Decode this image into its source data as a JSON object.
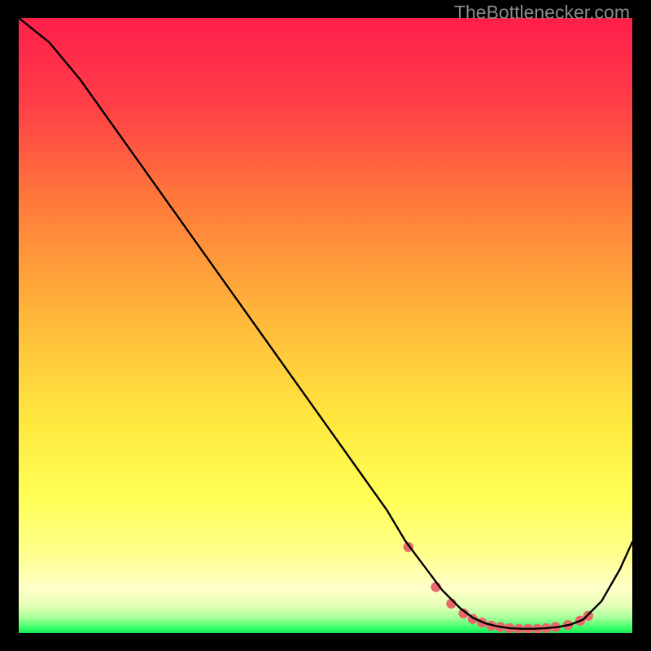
{
  "watermark": "TheBottlenecker.com",
  "colors": {
    "bg_black": "#000000",
    "grad_top": "#ff1f4a",
    "grad_mid_upper": "#ff7a3a",
    "grad_mid": "#ffd63a",
    "grad_yellow": "#ffff55",
    "grad_ylight": "#ffffa8",
    "grad_pale": "#e8ffb8",
    "grad_green": "#3cff66",
    "line": "#000000",
    "marker": "#e86a6a"
  },
  "chart_data": {
    "type": "line",
    "title": "",
    "xlabel": "",
    "ylabel": "",
    "xlim": [
      0,
      100
    ],
    "ylim": [
      0,
      100
    ],
    "series": [
      {
        "name": "curve",
        "x": [
          0,
          5,
          10,
          15,
          20,
          25,
          30,
          35,
          40,
          45,
          50,
          55,
          60,
          63,
          66,
          69,
          72,
          74,
          76,
          78,
          80,
          82,
          84,
          86,
          88,
          90,
          92,
          95,
          98,
          100
        ],
        "y": [
          100,
          96,
          90,
          83,
          76,
          69,
          62,
          55,
          48,
          41,
          34,
          27,
          20,
          15,
          11,
          7,
          4,
          2.5,
          1.6,
          1.1,
          0.8,
          0.7,
          0.7,
          0.8,
          1.0,
          1.4,
          2.2,
          5.2,
          10.4,
          14.8
        ]
      }
    ],
    "markers": {
      "name": "bottleneck-points",
      "x": [
        63.5,
        68.0,
        70.5,
        72.5,
        74.0,
        75.5,
        77.0,
        78.5,
        80.0,
        81.5,
        83.0,
        84.5,
        86.0,
        87.5,
        89.5,
        91.5,
        92.8
      ],
      "y": [
        14.0,
        7.5,
        4.8,
        3.2,
        2.3,
        1.7,
        1.2,
        1.0,
        0.8,
        0.7,
        0.7,
        0.7,
        0.8,
        1.0,
        1.3,
        2.0,
        2.8
      ]
    }
  }
}
